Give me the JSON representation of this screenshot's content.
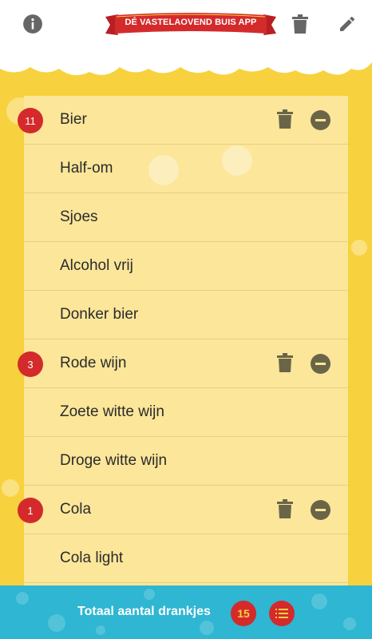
{
  "header": {
    "banner_text": "DÉ VASTELAOVEND BUIS APP",
    "info_icon": "info-icon",
    "trash_icon": "trash-icon",
    "edit_icon": "pencil-icon"
  },
  "drinks": [
    {
      "label": "Bier",
      "count": "11"
    },
    {
      "label": "Half-om",
      "count": null
    },
    {
      "label": "Sjoes",
      "count": null
    },
    {
      "label": "Alcohol vrij",
      "count": null
    },
    {
      "label": "Donker bier",
      "count": null
    },
    {
      "label": "Rode wijn",
      "count": "3"
    },
    {
      "label": "Zoete witte wijn",
      "count": null
    },
    {
      "label": "Droge witte wijn",
      "count": null
    },
    {
      "label": "Cola",
      "count": "1"
    },
    {
      "label": "Cola light",
      "count": null
    }
  ],
  "footer": {
    "total_label": "Totaal aantal drankjes",
    "total_count": "15",
    "list_icon": "list-icon"
  },
  "colors": {
    "background": "#f7d23e",
    "list_bg": "#fbe69a",
    "badge": "#d42a2c",
    "footer": "#2eb6d2",
    "icon": "#6b6548"
  }
}
